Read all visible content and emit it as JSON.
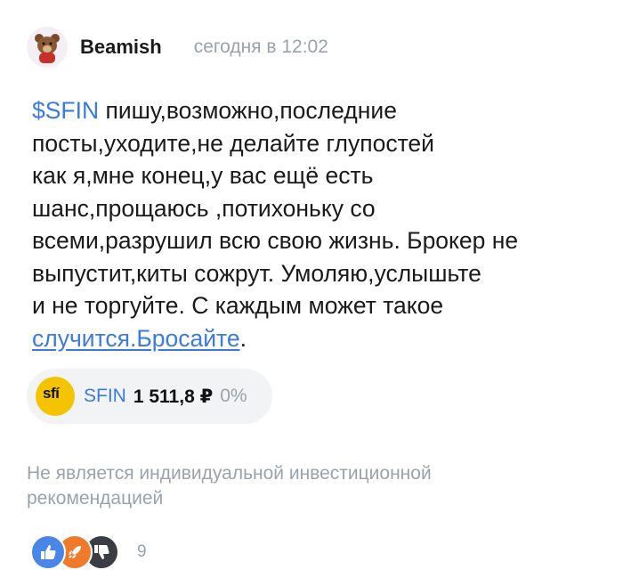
{
  "post": {
    "author": "Beamish",
    "time": "сегодня в 12:02",
    "avatar_icon": "teddy-bear-avatar-icon",
    "ticker_link": "$SFIN",
    "lines": [
      " пишу,возможно,последние",
      "посты,уходите,не делайте глупостей",
      "как я,мне конец,у вас ещё есть",
      "шанс,прощаюсь ,потихоньку со",
      "всеми,разрушил всю свою жизнь. Брокер не",
      "выпустит,киты сожрут. Умоляю,услышьте",
      "и не торгуйте. С каждым может такое"
    ],
    "tail_link": "случится.Бросайте",
    "tail_end": "."
  },
  "instrument": {
    "logo_text": "sfí",
    "ticker": "SFIN",
    "price": "1 511,8 ₽",
    "change": "0%",
    "logo_color": "#f5c400"
  },
  "disclaimer": "Не является индивидуальной инвестиционной рекомендацией",
  "reactions": {
    "icons": [
      "thumbs-up-icon",
      "rocket-icon",
      "thumbs-down-icon"
    ],
    "count": "9"
  },
  "colors": {
    "accent": "#3b7ae0",
    "muted": "#9aa3ab"
  }
}
